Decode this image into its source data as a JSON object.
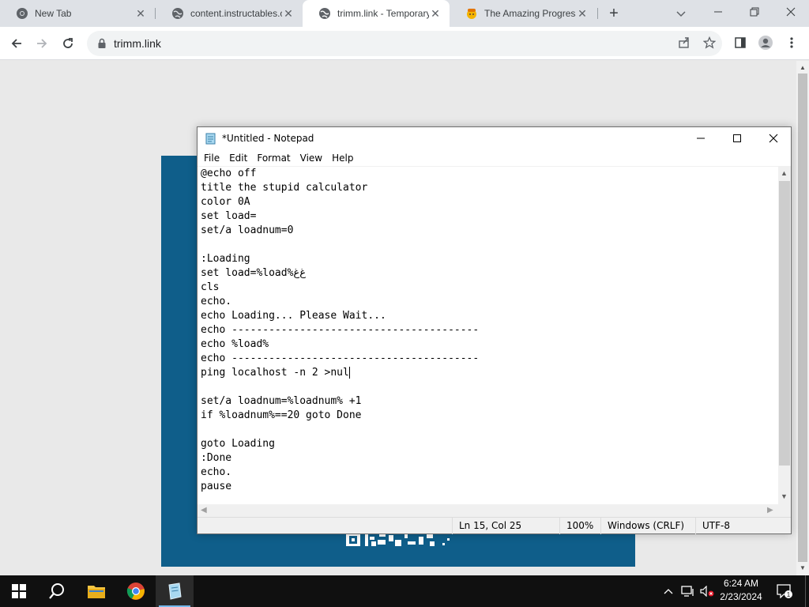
{
  "browser": {
    "tabs": [
      {
        "title": "New Tab",
        "icon": "chrome-icon",
        "active": false
      },
      {
        "title": "content.instructables.co",
        "icon": "globe-icon",
        "active": false
      },
      {
        "title": "trimm.link - Temporary",
        "icon": "globe-icon",
        "active": true
      },
      {
        "title": "The Amazing Progress",
        "icon": "emoji-icon",
        "active": false
      }
    ],
    "address": "trimm.link"
  },
  "notepad": {
    "title": "*Untitled - Notepad",
    "menu": [
      "File",
      "Edit",
      "Format",
      "View",
      "Help"
    ],
    "lines": [
      "@echo off",
      "title the stupid calculator",
      "color 0A",
      "set load=",
      "set/a loadnum=0",
      "",
      ":Loading",
      "set load=%load%ﻍﻍ",
      "cls",
      "echo.",
      "echo Loading... Please Wait...",
      "echo ----------------------------------------",
      "echo %load%",
      "echo ----------------------------------------",
      "ping localhost -n 2 >nul",
      "",
      "set/a loadnum=%loadnum% +1",
      "if %loadnum%==20 goto Done",
      "",
      "goto Loading",
      ":Done",
      "echo.",
      "pause"
    ],
    "cursor_line": 14,
    "status": {
      "position": "Ln 15, Col 25",
      "zoom": "100%",
      "line_ending": "Windows (CRLF)",
      "encoding": "UTF-8"
    }
  },
  "taskbar": {
    "time": "6:24 AM",
    "date": "2/23/2024",
    "notification_count": "1"
  },
  "colors": {
    "tabstrip": "#dee1e6",
    "page_card": "#0f5e8a",
    "taskbar": "#101010"
  }
}
